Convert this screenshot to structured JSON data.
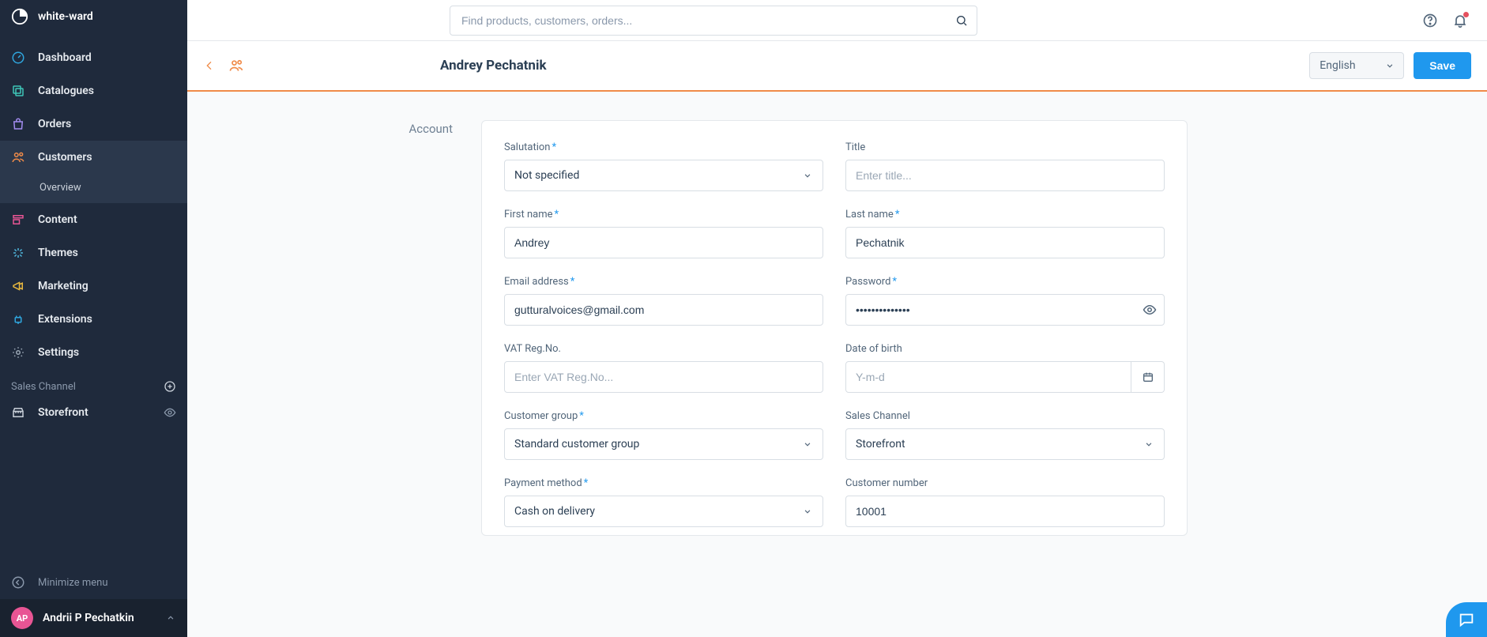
{
  "brand": "white-ward",
  "nav": {
    "dashboard": "Dashboard",
    "catalogues": "Catalogues",
    "orders": "Orders",
    "customers": "Customers",
    "customers_overview": "Overview",
    "content": "Content",
    "themes": "Themes",
    "marketing": "Marketing",
    "extensions": "Extensions",
    "settings": "Settings"
  },
  "sales_channel_label": "Sales Channel",
  "channels": {
    "storefront": "Storefront"
  },
  "minimize": "Minimize menu",
  "user": {
    "initials": "AP",
    "name": "Andrii P Pechatkin"
  },
  "search": {
    "placeholder": "Find products, customers, orders..."
  },
  "header": {
    "title": "Andrey Pechatnik",
    "language": "English",
    "save": "Save"
  },
  "section": {
    "account": "Account"
  },
  "form": {
    "salutation": {
      "label": "Salutation",
      "value": "Not specified"
    },
    "title": {
      "label": "Title",
      "placeholder": "Enter title..."
    },
    "first_name": {
      "label": "First name",
      "value": "Andrey"
    },
    "last_name": {
      "label": "Last name",
      "value": "Pechatnik"
    },
    "email": {
      "label": "Email address",
      "value": "gutturalvoices@gmail.com"
    },
    "password": {
      "label": "Password",
      "value": "••••••••••••••"
    },
    "vat": {
      "label": "VAT Reg.No.",
      "placeholder": "Enter VAT Reg.No..."
    },
    "dob": {
      "label": "Date of birth",
      "placeholder": "Y-m-d"
    },
    "customer_group": {
      "label": "Customer group",
      "value": "Standard customer group"
    },
    "sales_channel": {
      "label": "Sales Channel",
      "value": "Storefront"
    },
    "payment_method": {
      "label": "Payment method",
      "value": "Cash on delivery"
    },
    "customer_number": {
      "label": "Customer number",
      "value": "10001"
    }
  }
}
